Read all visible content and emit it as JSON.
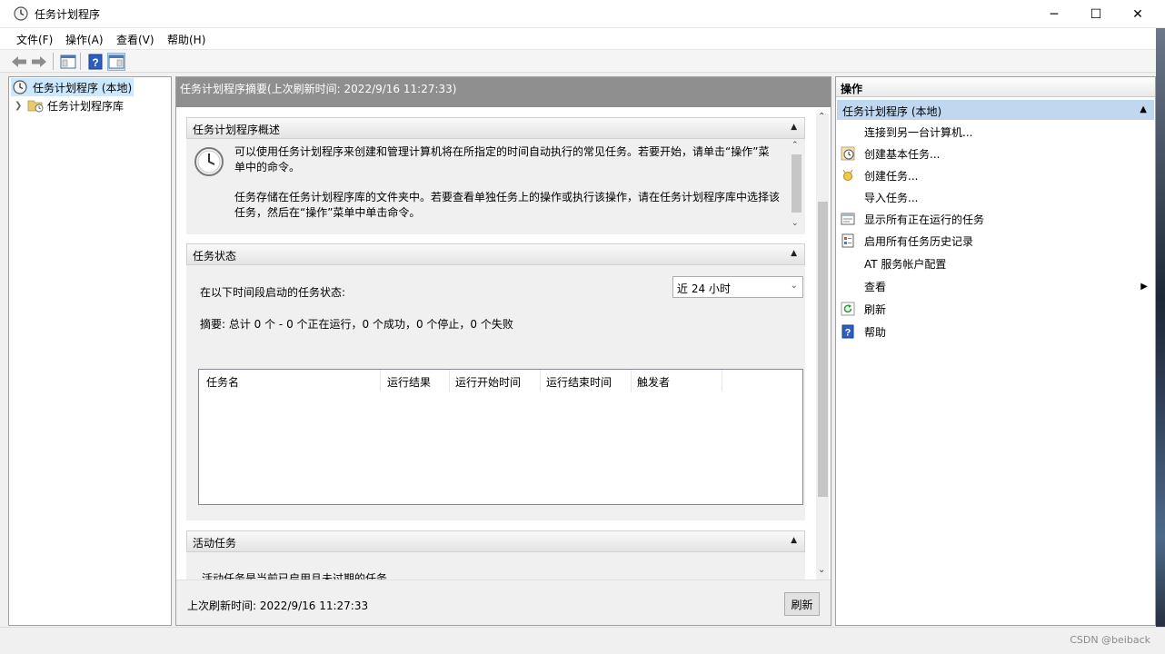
{
  "window": {
    "title": "任务计划程序",
    "minimize": "─",
    "maximize": "☐",
    "close": "✕"
  },
  "menu": {
    "items": [
      "文件(F)",
      "操作(A)",
      "查看(V)",
      "帮助(H)"
    ]
  },
  "tree": {
    "root": "任务计划程序 (本地)",
    "library": "任务计划程序库"
  },
  "center": {
    "header": "任务计划程序摘要(上次刷新时间: 2022/9/16 11:27:33)",
    "overview": {
      "title": "任务计划程序概述",
      "para1": "可以使用任务计划程序来创建和管理计算机将在所指定的时间自动执行的常见任务。若要开始，请单击“操作”菜单中的命令。",
      "para2": "任务存储在任务计划程序库的文件夹中。若要查看单独任务上的操作或执行该操作，请在任务计划程序库中选择该任务，然后在“操作”菜单中单击命令。"
    },
    "status": {
      "title": "任务状态",
      "range_label": "在以下时间段启动的任务状态:",
      "range_value": "近 24 小时",
      "summary": "摘要: 总计 0 个 - 0 个正在运行，0 个成功，0 个停止，0 个失败",
      "columns": [
        "任务名",
        "运行结果",
        "运行开始时间",
        "运行结束时间",
        "触发者"
      ]
    },
    "active": {
      "title": "活动任务",
      "text": "活动任务是当前已启用且未过期的任务。"
    },
    "footer": {
      "last_refresh": "上次刷新时间: 2022/9/16 11:27:33",
      "refresh_button": "刷新"
    }
  },
  "actions": {
    "title": "操作",
    "group": "任务计划程序 (本地)",
    "items": [
      {
        "label": "连接到另一台计算机...",
        "icon": "none"
      },
      {
        "label": "创建基本任务...",
        "icon": "clock-icon"
      },
      {
        "label": "创建任务...",
        "icon": "new-task-icon"
      },
      {
        "label": "导入任务...",
        "icon": "none"
      },
      {
        "label": "显示所有正在运行的任务",
        "icon": "running-tasks-icon"
      },
      {
        "label": "启用所有任务历史记录",
        "icon": "history-icon"
      },
      {
        "label": "AT 服务帐户配置",
        "icon": "none"
      },
      {
        "label": "查看",
        "icon": "none"
      },
      {
        "label": "刷新",
        "icon": "refresh-icon"
      },
      {
        "label": "帮助",
        "icon": "help-icon"
      }
    ]
  },
  "watermark": "CSDN @beiback",
  "colors": {
    "selected_tree": "#cce8ff",
    "center_header": "#8f8f8f",
    "actions_group": "#bfd7ef"
  }
}
